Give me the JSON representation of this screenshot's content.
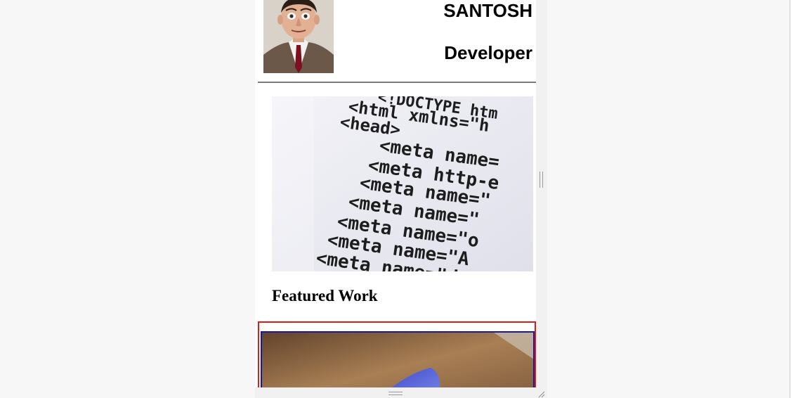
{
  "header": {
    "name": "SANTOSH",
    "role": "Developer"
  },
  "hero": {
    "code_lines": [
      "<!DOCTYPE htm",
      "<html xmlns=\"h",
      "<head>",
      "<meta name=",
      "<meta http-e",
      "<meta name=\"",
      "<meta name=\"",
      "<meta name=\"o",
      "<meta name=\"A",
      "<meta name=\"d"
    ]
  },
  "featured": {
    "title": "Featured Work"
  },
  "colors": {
    "card_border": "#e01a1a",
    "card_inner_border": "#1a1a99"
  }
}
